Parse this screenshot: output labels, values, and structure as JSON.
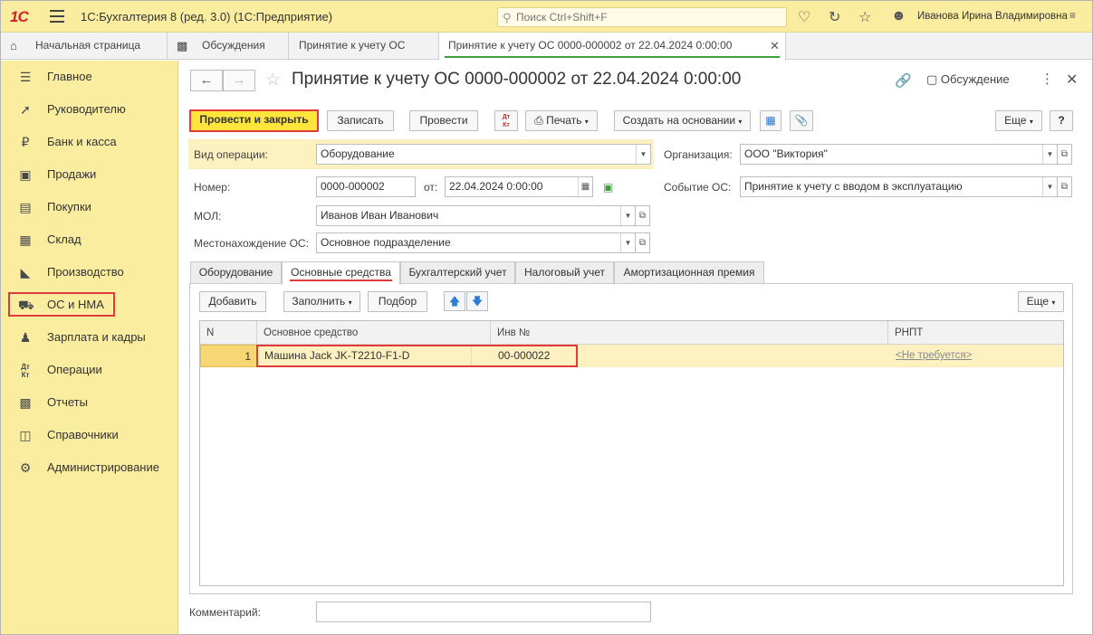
{
  "app": {
    "logo": "1С",
    "title": "1С:Бухгалтерия 8 (ред. 3.0)  (1С:Предприятие)",
    "search_placeholder": "Поиск Ctrl+Shift+F",
    "user": "Иванова Ирина Владимировна"
  },
  "tabs": [
    {
      "label": "Начальная страница",
      "icon": "home-icon"
    },
    {
      "label": "Обсуждения",
      "icon": "chat-icon"
    },
    {
      "label": "Принятие к учету ОС"
    },
    {
      "label": "Принятие к учету ОС 0000-000002 от 22.04.2024 0:00:00",
      "active": true
    }
  ],
  "sidebar": {
    "items": [
      {
        "label": "Главное",
        "icon": "list-icon"
      },
      {
        "label": "Руководителю",
        "icon": "trend-icon"
      },
      {
        "label": "Банк и касса",
        "icon": "coin-icon"
      },
      {
        "label": "Продажи",
        "icon": "bag-icon"
      },
      {
        "label": "Покупки",
        "icon": "cart-icon"
      },
      {
        "label": "Склад",
        "icon": "warehouse-icon"
      },
      {
        "label": "Производство",
        "icon": "factory-icon"
      },
      {
        "label": "ОС и НМА",
        "icon": "truck-icon"
      },
      {
        "label": "Зарплата и кадры",
        "icon": "person-icon"
      },
      {
        "label": "Операции",
        "icon": "dt-kt-icon"
      },
      {
        "label": "Отчеты",
        "icon": "bar-chart-icon"
      },
      {
        "label": "Справочники",
        "icon": "books-icon"
      },
      {
        "label": "Администрирование",
        "icon": "gear-icon"
      }
    ]
  },
  "doc": {
    "title": "Принятие к учету ОС 0000-000002 от 22.04.2024 0:00:00",
    "discussion": "Обсуждение"
  },
  "toolbar": {
    "post_close": "Провести и закрыть",
    "save": "Записать",
    "post": "Провести",
    "dtkt": "Дт Кт",
    "print": "Печать",
    "create_based": "Создать на основании",
    "more": "Еще",
    "help": "?"
  },
  "form": {
    "op_type_label": "Вид операции:",
    "op_type_value": "Оборудование",
    "org_label": "Организация:",
    "org_value": "ООО \"Виктория\"",
    "number_label": "Номер:",
    "number_value": "0000-000002",
    "date_label": "от:",
    "date_value": "22.04.2024  0:00:00",
    "event_label": "Событие ОС:",
    "event_value": "Принятие к учету с вводом в эксплуатацию",
    "mol_label": "МОЛ:",
    "mol_value": "Иванов Иван Иванович",
    "location_label": "Местонахождение ОС:",
    "location_value": "Основное подразделение",
    "comment_label": "Комментарий:",
    "comment_value": ""
  },
  "form_tabs": [
    "Оборудование",
    "Основные средства",
    "Бухгалтерский учет",
    "Налоговый учет",
    "Амортизационная премия"
  ],
  "table_toolbar": {
    "add": "Добавить",
    "fill": "Заполнить",
    "pick": "Подбор",
    "more": "Еще"
  },
  "table": {
    "columns": [
      "N",
      "Основное средство",
      "Инв №",
      "РНПТ"
    ],
    "rows": [
      {
        "n": "1",
        "asset": "Машина Jack JK-T2210-F1-D",
        "inv": "00-000022",
        "rnpt": "<Не требуется>"
      }
    ]
  }
}
